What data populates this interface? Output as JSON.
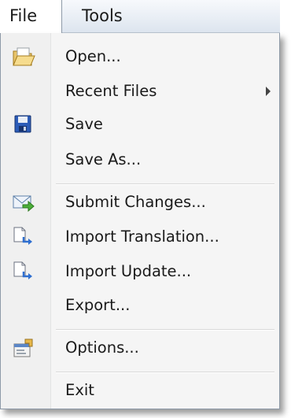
{
  "menubar": {
    "items": [
      {
        "label": "File"
      },
      {
        "label": "Tools"
      }
    ]
  },
  "file_menu": {
    "items": [
      {
        "label": "Open...",
        "icon": "open-folder-icon"
      },
      {
        "label": "Recent Files",
        "has_submenu": true
      },
      {
        "label": "Save",
        "icon": "save-disk-icon"
      },
      {
        "label": "Save As..."
      },
      {
        "label": "Submit Changes...",
        "icon": "submit-envelope-icon"
      },
      {
        "label": "Import Translation...",
        "icon": "import-document-icon"
      },
      {
        "label": "Import Update...",
        "icon": "import-document-icon"
      },
      {
        "label": "Export..."
      },
      {
        "label": "Options...",
        "icon": "options-icon"
      },
      {
        "label": "Exit"
      }
    ]
  },
  "colors": {
    "menubar_gradient_top": "#f7f9fc",
    "menubar_gradient_bottom": "#dde5ef",
    "menu_background": "#f5f5f5",
    "border": "#8e9aa8"
  }
}
